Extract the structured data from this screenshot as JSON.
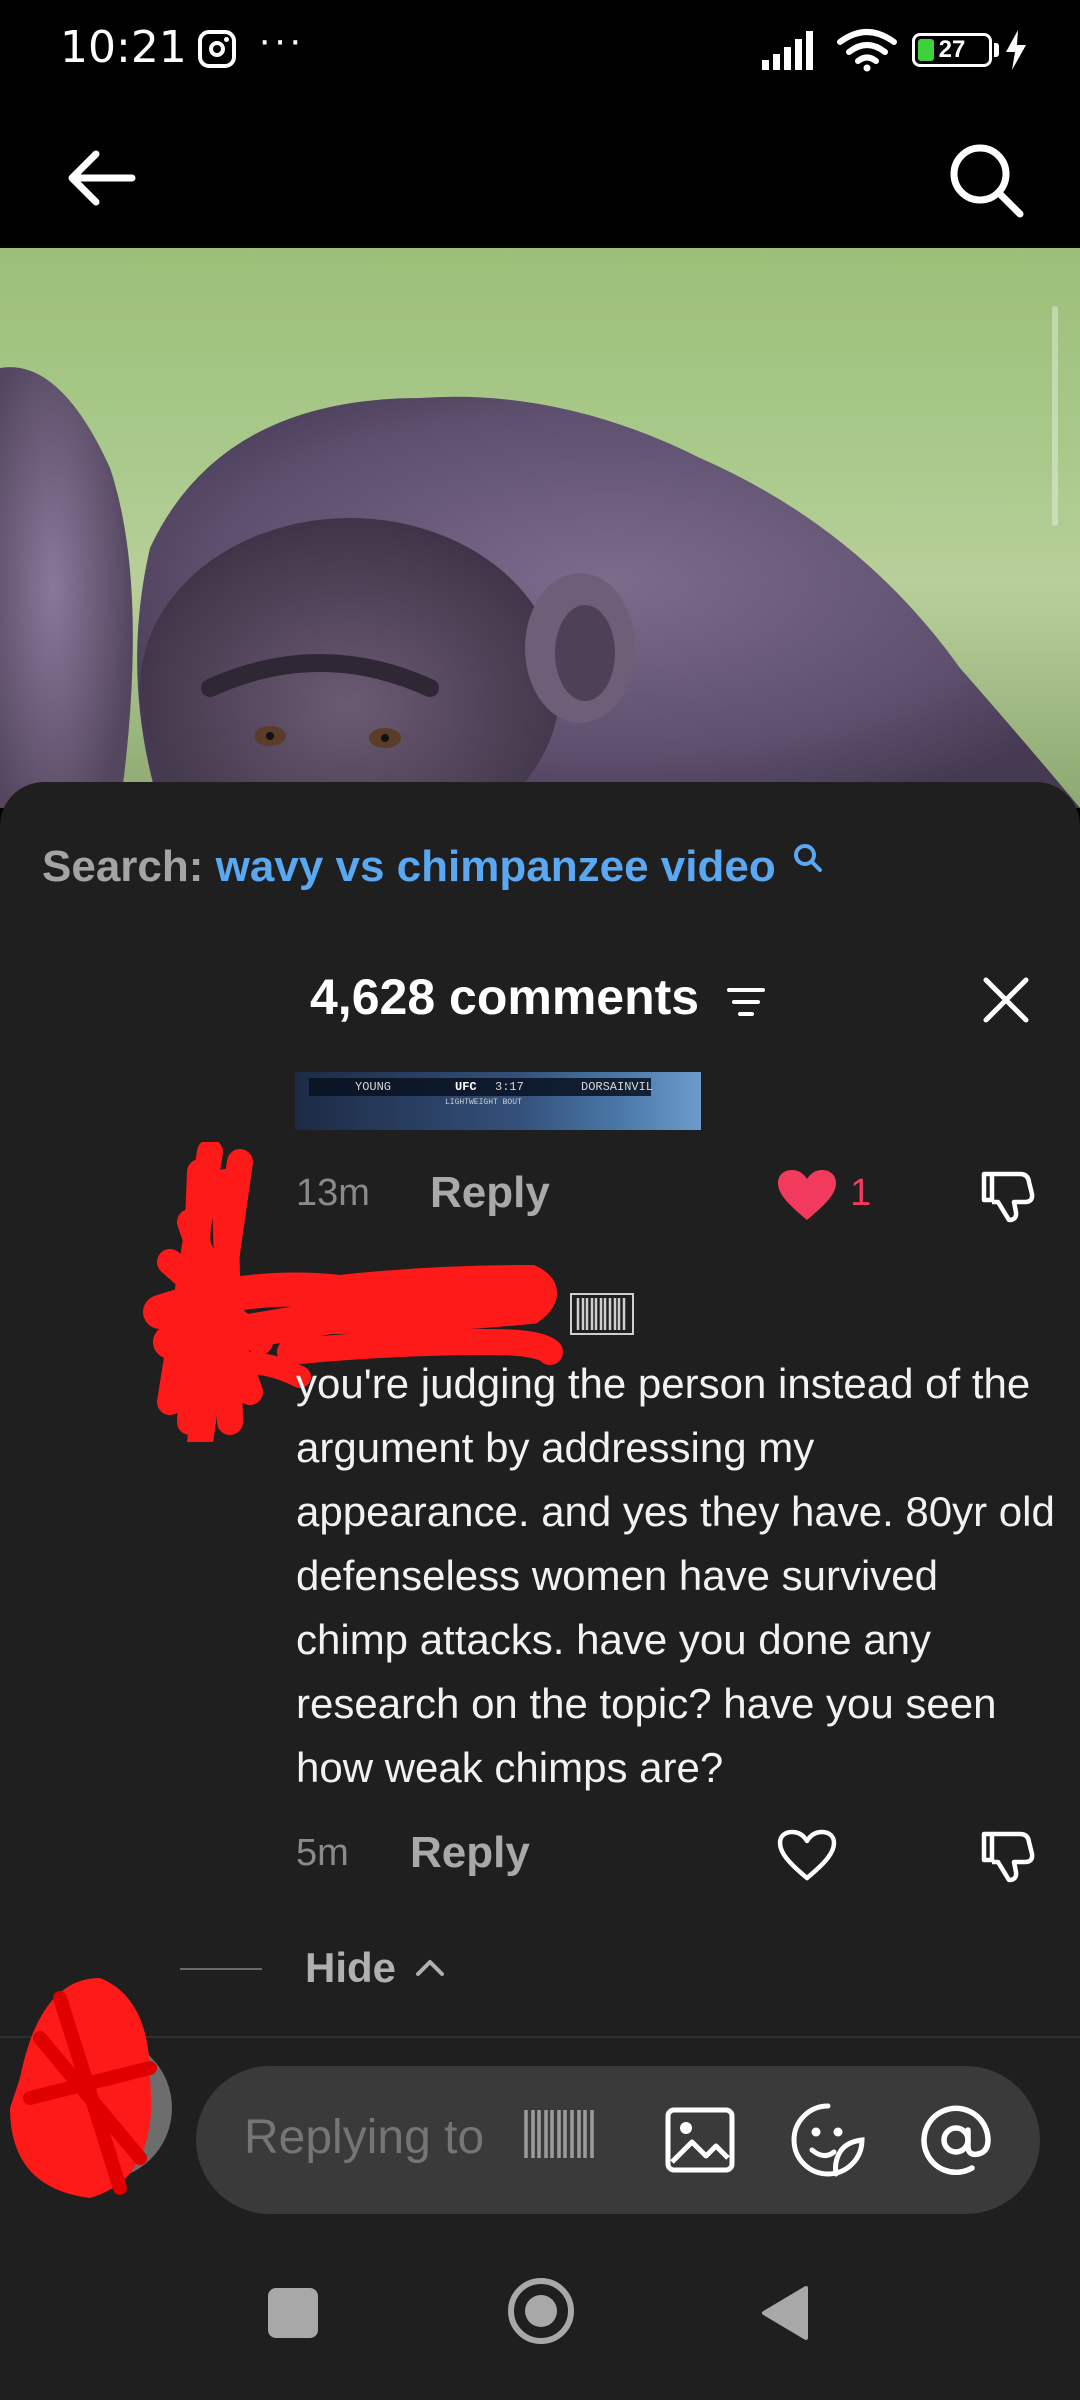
{
  "status_bar": {
    "time": "10:21",
    "battery_level": "27",
    "more": "···",
    "icons": [
      "instagram-icon",
      "signal-icon",
      "wifi-icon",
      "battery-icon",
      "charging-icon"
    ]
  },
  "top_nav": {
    "icons": [
      "back-arrow-icon",
      "search-icon"
    ]
  },
  "comments_sheet": {
    "search_prefix": "Search:",
    "search_query": "wavy vs chimpanzee video",
    "comments_count": "4,628 comments",
    "thumbnail_strip": {
      "left_name": "YOUNG",
      "league": "UFC",
      "clock": "3:17",
      "right_name": "DORSAINVIL",
      "division": "LIGHTWEIGHT BOUT"
    },
    "first_comment": {
      "time": "13m",
      "reply_label": "Reply",
      "likes": "1",
      "liked": true
    },
    "second_comment": {
      "text": "you're judging the person instead of the argument by addressing my appearance. and yes they have. 80yr old defenseless women have survived chimp attacks. have you done any research on the topic? have you seen how weak chimps are?",
      "time": "5m",
      "reply_label": "Reply",
      "liked": false
    },
    "hide_label": "Hide"
  },
  "composer": {
    "placeholder": "Replying to",
    "icons": [
      "image-icon",
      "emoji-sticker-icon",
      "mention-icon"
    ]
  },
  "colors": {
    "sheet_bg": "#1f1f1f",
    "link_blue": "#5aa7f2",
    "like_red": "#f23b5c",
    "redaction_red": "#ff0000"
  }
}
